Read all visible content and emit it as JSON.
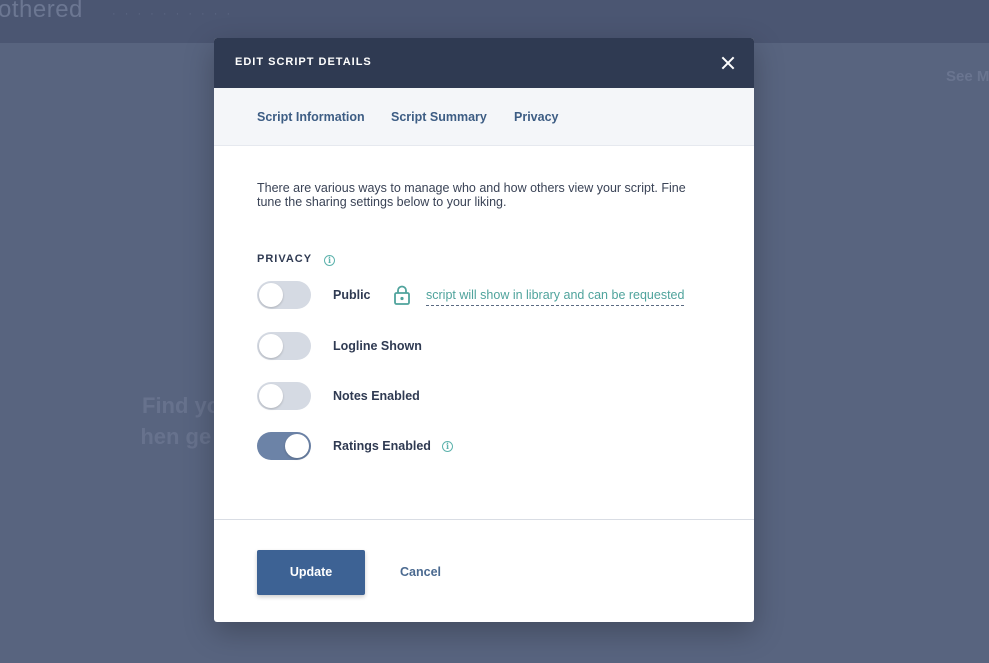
{
  "background": {
    "logo": "othered",
    "nav_text": "· · · · · · · · · ·",
    "see_more": "See M",
    "find_text_line1": "Find yo",
    "find_text_line2": "then ge"
  },
  "modal": {
    "title": "EDIT SCRIPT DETAILS",
    "tabs": [
      {
        "label": "Script Information"
      },
      {
        "label": "Script Summary"
      },
      {
        "label": "Privacy"
      }
    ],
    "description": "There are various ways to manage who and how others view your script. Fine tune the sharing settings below to your liking.",
    "privacy_section_label": "PRIVACY",
    "settings": [
      {
        "label": "Public",
        "enabled": false,
        "note": "script will show in library and can be requested"
      },
      {
        "label": "Logline Shown",
        "enabled": false
      },
      {
        "label": "Notes Enabled",
        "enabled": false
      },
      {
        "label": "Ratings Enabled",
        "enabled": true
      }
    ],
    "update_label": "Update",
    "cancel_label": "Cancel"
  },
  "colors": {
    "overlay": "#58647f",
    "header": "#2f3a52",
    "accent": "#3d6294",
    "toggle_on": "#6c83a7",
    "toggle_off": "#d5dae3",
    "teal": "#4fa39c"
  },
  "icons": {
    "close": "close-icon",
    "info": "info-icon",
    "lock": "lock-icon"
  }
}
